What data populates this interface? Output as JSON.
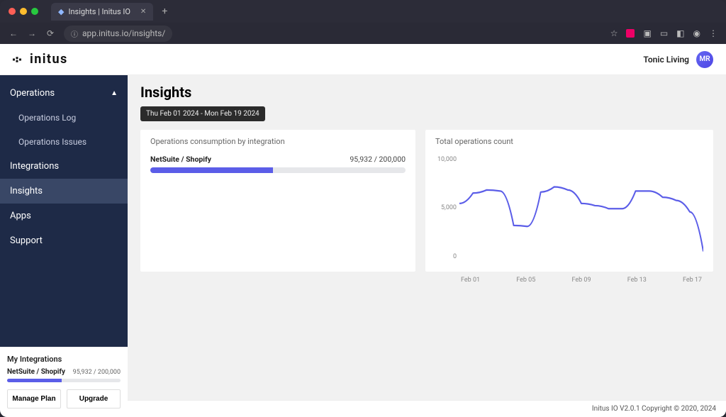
{
  "browser": {
    "tab_title": "Insights | Initus IO",
    "url": "app.initus.io/insights/"
  },
  "header": {
    "logo_text": "initus",
    "org_name": "Tonic Living",
    "avatar_initials": "MR"
  },
  "sidebar": {
    "items": [
      {
        "label": "Operations",
        "expanded": true,
        "sub": [
          {
            "label": "Operations Log"
          },
          {
            "label": "Operations Issues"
          }
        ]
      },
      {
        "label": "Integrations"
      },
      {
        "label": "Insights",
        "active": true
      },
      {
        "label": "Apps"
      },
      {
        "label": "Support"
      }
    ],
    "my_integrations_label": "My Integrations",
    "mini_integration": {
      "name": "NetSuite / Shopify",
      "count_display": "95,932 / 200,000",
      "pct": 48
    },
    "buttons": {
      "manage": "Manage Plan",
      "upgrade": "Upgrade"
    }
  },
  "page": {
    "title": "Insights",
    "date_range": "Thu Feb 01 2024 - Mon Feb 19 2024",
    "card1": {
      "title": "Operations consumption by integration",
      "integration": {
        "name": "NetSuite / Shopify",
        "count_display": "95,932 / 200,000",
        "pct": 48
      }
    },
    "card2": {
      "title": "Total operations count",
      "y_ticks": [
        "10,000",
        "5,000",
        "0"
      ],
      "x_ticks": [
        "Feb 01",
        "Feb 05",
        "Feb 09",
        "Feb 13",
        "Feb 17"
      ]
    }
  },
  "footer": "Initus IO V2.0.1 Copyright © 2020, 2024",
  "chart_data": {
    "type": "line",
    "title": "Total operations count",
    "xlabel": "",
    "ylabel": "",
    "ylim": [
      0,
      10000
    ],
    "categories": [
      "Feb 01",
      "Feb 02",
      "Feb 03",
      "Feb 04",
      "Feb 05",
      "Feb 06",
      "Feb 07",
      "Feb 08",
      "Feb 09",
      "Feb 10",
      "Feb 11",
      "Feb 12",
      "Feb 13",
      "Feb 14",
      "Feb 15",
      "Feb 16",
      "Feb 17",
      "Feb 18",
      "Feb 19"
    ],
    "values": [
      5300,
      6300,
      6600,
      6500,
      3200,
      3100,
      6400,
      6900,
      6600,
      5300,
      5100,
      4800,
      4800,
      6500,
      6500,
      5900,
      5600,
      4500,
      700
    ]
  }
}
